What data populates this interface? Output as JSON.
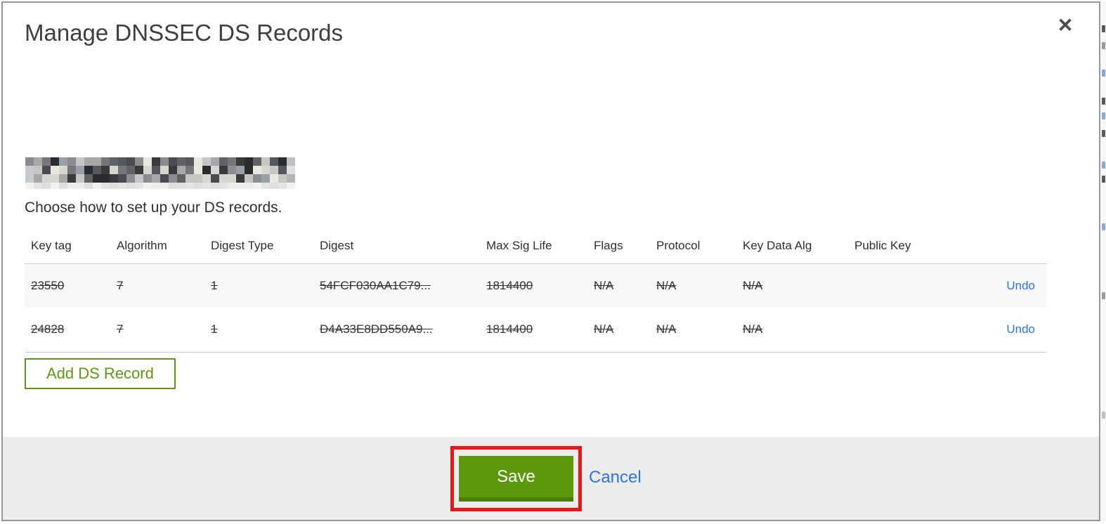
{
  "modal": {
    "title": "Manage DNSSEC DS Records",
    "close_glyph": "×",
    "subtitle": "Choose how to set up your DS records.",
    "table": {
      "headers": [
        "Key tag",
        "Algorithm",
        "Digest Type",
        "Digest",
        "Max Sig Life",
        "Flags",
        "Protocol",
        "Key Data Alg",
        "Public Key"
      ],
      "rows": [
        {
          "cells": [
            "23550",
            "7",
            "1",
            "54FCF030AA1C79...",
            "1814400",
            "N/A",
            "N/A",
            "N/A",
            ""
          ],
          "action": "Undo",
          "struck": true
        },
        {
          "cells": [
            "24828",
            "7",
            "1",
            "D4A33E8DD550A9...",
            "1814400",
            "N/A",
            "N/A",
            "N/A",
            ""
          ],
          "action": "Undo",
          "struck": true
        }
      ]
    },
    "add_button_label": "Add DS Record",
    "footer": {
      "save_label": "Save",
      "cancel_label": "Cancel"
    }
  },
  "colors": {
    "accent_green": "#5b990b",
    "accent_green_dark": "#4b7d09",
    "outline_green": "#5f9914",
    "link_blue": "#2b74e8",
    "annotation_red": "#ec1414",
    "footer_bg": "#ececec",
    "row_alt_bg": "#f8f8f8"
  }
}
